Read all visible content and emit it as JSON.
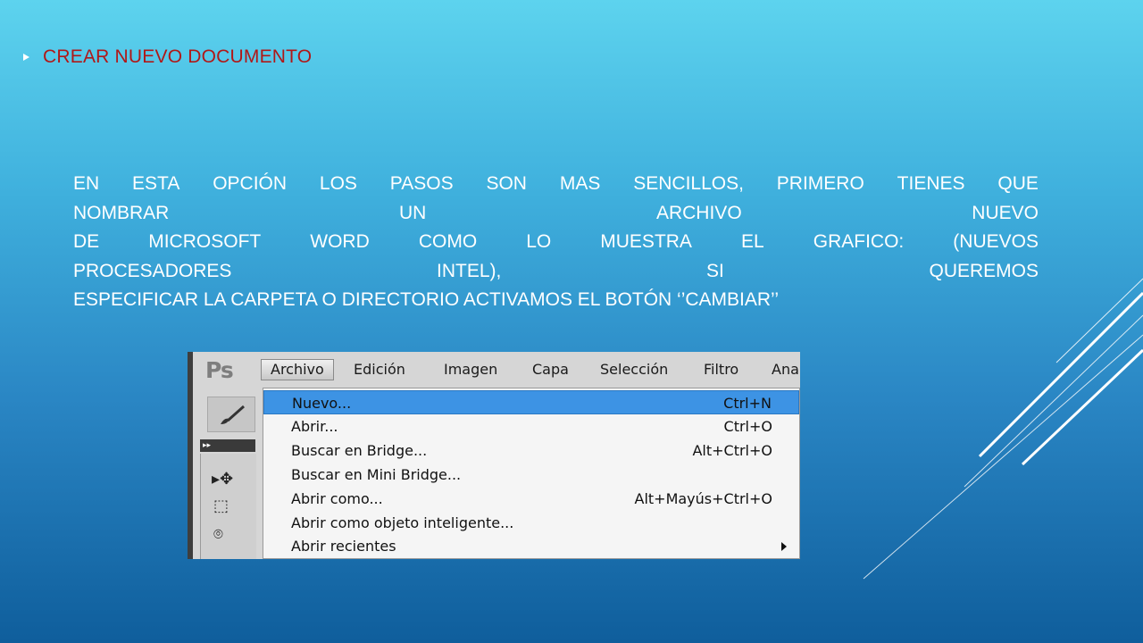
{
  "slide": {
    "heading": "CREAR NUEVO DOCUMENTO",
    "body_lines": [
      [
        "EN",
        "ESTA",
        "OPCIÓN",
        "LOS",
        "PASOS",
        "SON",
        "MAS",
        "SENCILLOS,",
        "PRIMERO",
        "TIENES",
        "QUE"
      ],
      [
        "NOMBRAR",
        "UN",
        "ARCHIVO",
        "NUEVO"
      ],
      [
        "DE",
        "MICROSOFT",
        "WORD",
        "COMO",
        "LO",
        "MUESTRA",
        "EL",
        "GRAFICO:",
        "(NUEVOS"
      ],
      [
        "PROCESADORES",
        "INTEL),",
        "SI",
        "QUEREMOS"
      ]
    ],
    "body_last_line": "ESPECIFICAR LA CARPETA O DIRECTORIO ACTIVAMOS EL BOTÓN ‘’CAMBIAR’’",
    "colors": {
      "heading": "#b01818",
      "body_text": "#ffffff",
      "bg_top": "#5dd3ee",
      "bg_bottom": "#0f5e9c"
    }
  },
  "screenshot": {
    "logo": "Ps",
    "menu": [
      "Archivo",
      "Edición",
      "Imagen",
      "Capa",
      "Selección",
      "Filtro",
      "Ana"
    ],
    "active_menu": "Archivo",
    "dropdown_items": [
      {
        "label": "Nuevo...",
        "shortcut": "Ctrl+N",
        "highlighted": true
      },
      {
        "label": "Abrir...",
        "shortcut": "Ctrl+O"
      },
      {
        "label": "Buscar en Bridge...",
        "shortcut": "Alt+Ctrl+O"
      },
      {
        "label": "Buscar en Mini Bridge...",
        "shortcut": ""
      },
      {
        "label": "Abrir como...",
        "shortcut": "Alt+Mayús+Ctrl+O"
      },
      {
        "label": "Abrir como objeto inteligente...",
        "shortcut": ""
      },
      {
        "label": "Abrir recientes",
        "shortcut": "",
        "submenu": true
      }
    ],
    "toolbar_collapse_glyph": "▸▸",
    "tool_icons": [
      "brush-icon",
      "move-tool-icon",
      "marquee-tool-icon",
      "lasso-tool-icon"
    ],
    "colors": {
      "highlight": "#3d93e4",
      "menu_bg": "#f5f5f5",
      "chrome_bg": "#d6d6d6"
    }
  }
}
